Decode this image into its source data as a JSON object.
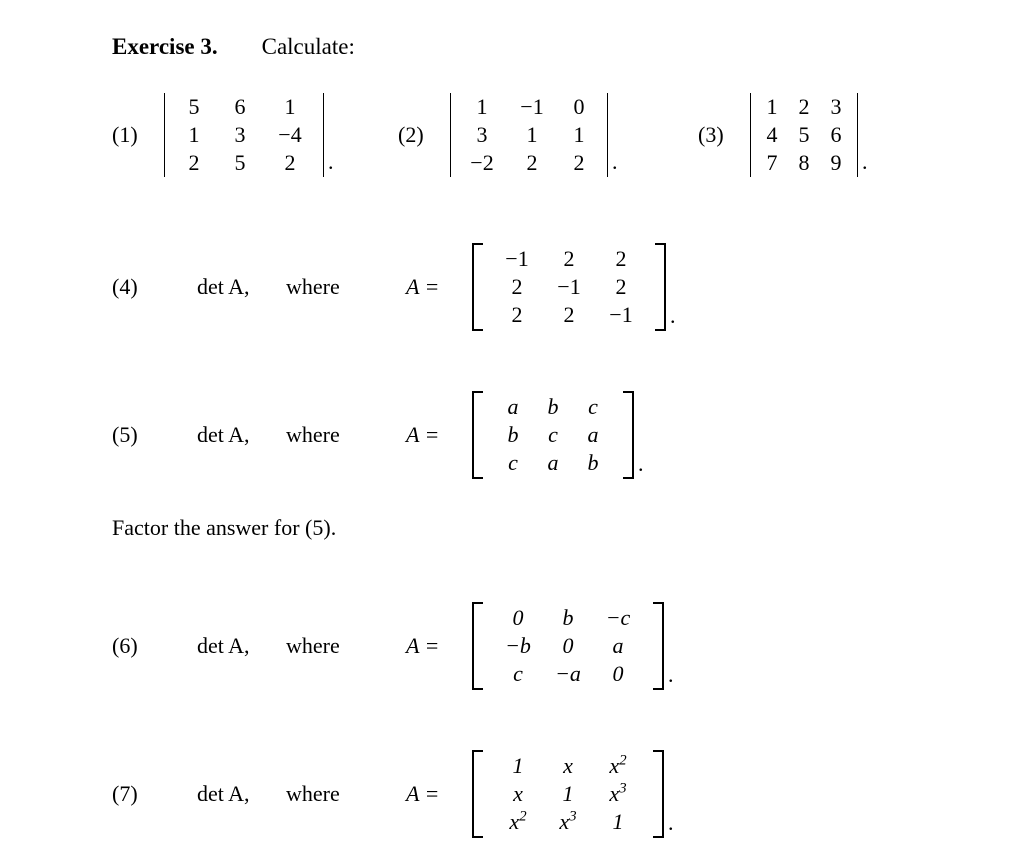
{
  "document": {
    "background_color": "#ffffff",
    "text_color": "#000000",
    "header": {
      "exercise_label": "Exercise 3.",
      "instruction": "Calculate:"
    },
    "factor_note": "Factor the answer for (5).",
    "det_word": "det A,",
    "where_word": "where",
    "assign_word": "A =",
    "period": "."
  },
  "problems": [
    {
      "label": "(1)",
      "delimiter": "vertical-bar",
      "rows": [
        [
          "5",
          "6",
          "1"
        ],
        [
          "1",
          "3",
          "−4"
        ],
        [
          "2",
          "5",
          "2"
        ]
      ]
    },
    {
      "label": "(2)",
      "delimiter": "vertical-bar",
      "rows": [
        [
          "1",
          "−1",
          "0"
        ],
        [
          "3",
          "1",
          "1"
        ],
        [
          "−2",
          "2",
          "2"
        ]
      ]
    },
    {
      "label": "(3)",
      "delimiter": "vertical-bar",
      "rows": [
        [
          "1",
          "2",
          "3"
        ],
        [
          "4",
          "5",
          "6"
        ],
        [
          "7",
          "8",
          "9"
        ]
      ]
    },
    {
      "label": "(4)",
      "delimiter": "bracket",
      "rows": [
        [
          "−1",
          "2",
          "2"
        ],
        [
          "2",
          "−1",
          "2"
        ],
        [
          "2",
          "2",
          "−1"
        ]
      ]
    },
    {
      "label": "(5)",
      "delimiter": "bracket",
      "rows": [
        [
          "a",
          "b",
          "c"
        ],
        [
          "b",
          "c",
          "a"
        ],
        [
          "c",
          "a",
          "b"
        ]
      ]
    },
    {
      "label": "(6)",
      "delimiter": "bracket",
      "rows": [
        [
          "0",
          "b",
          "−c"
        ],
        [
          "−b",
          "0",
          "a"
        ],
        [
          "c",
          "−a",
          "0"
        ]
      ]
    },
    {
      "label": "(7)",
      "delimiter": "bracket",
      "rows": [
        [
          "1",
          "x",
          "x2"
        ],
        [
          "x",
          "1",
          "x3"
        ],
        [
          "x2",
          "x3",
          "1"
        ]
      ]
    }
  ]
}
